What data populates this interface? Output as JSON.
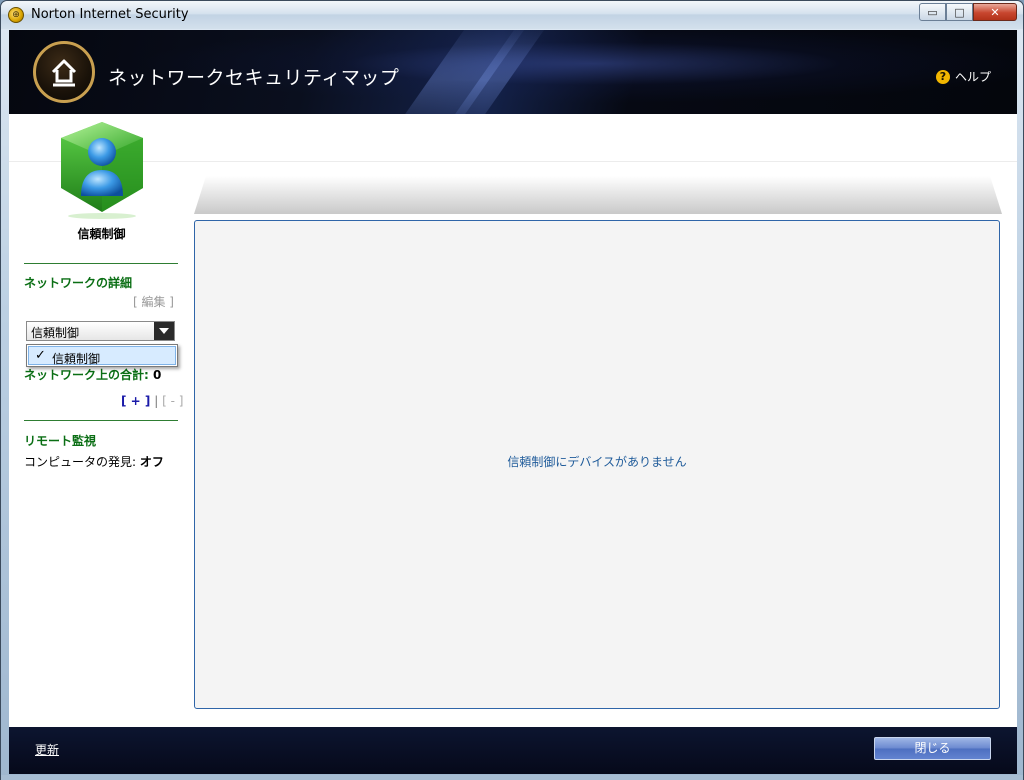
{
  "window": {
    "title": "Norton Internet Security",
    "controls": {
      "minimize": "▭",
      "maximize": "□",
      "close": "✕"
    }
  },
  "header": {
    "title": "ネットワークセキュリティマップ",
    "help_label": "ヘルプ",
    "help_icon_glyph": "?"
  },
  "sidebar": {
    "trust_label": "信頼制御",
    "network_details_title": "ネットワークの詳細",
    "edit_link": "[ 編集 ]",
    "select": {
      "value": "信頼制御",
      "options": [
        "信頼制御"
      ]
    },
    "dropdown_check": "✓",
    "network_total_label": "ネットワーク上の合計:",
    "network_total_count": "0",
    "add_link": "[ + ]",
    "separator": "|",
    "remove_link": "[ - ]",
    "remote_title": "リモート監視",
    "computer_discovery_label": "コンピュータの発見:",
    "computer_discovery_value": "オフ"
  },
  "main": {
    "empty_message": "信頼制御にデバイスがありません"
  },
  "footer": {
    "refresh_label": "更新",
    "close_label": "閉じる"
  },
  "colors": {
    "accent_green": "#0a6e14",
    "link_blue": "#1a1aa8",
    "message_blue": "#1f5b9a",
    "header_dark": "#05070f",
    "footer_dark": "#0c1530",
    "home_ring": "#c9a050",
    "help_icon": "#f2b600"
  },
  "icons": {
    "app": "norton-globe-icon",
    "home": "home-icon",
    "help": "help-icon",
    "trust": "user-cube-icon",
    "dropdown": "chevron-down-icon"
  }
}
